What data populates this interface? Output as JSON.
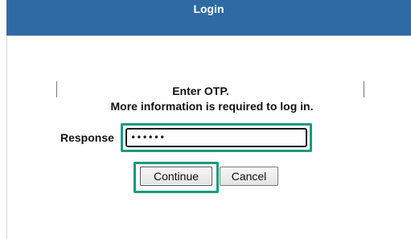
{
  "window": {
    "title": "Login"
  },
  "messages": {
    "line1": "Enter OTP.",
    "line2": "More information is required to log in."
  },
  "form": {
    "response_label": "Response",
    "response_value": "••••••"
  },
  "buttons": {
    "continue": "Continue",
    "cancel": "Cancel"
  },
  "colors": {
    "titlebar": "#2f6aa5",
    "highlight": "#1d9a7c"
  }
}
